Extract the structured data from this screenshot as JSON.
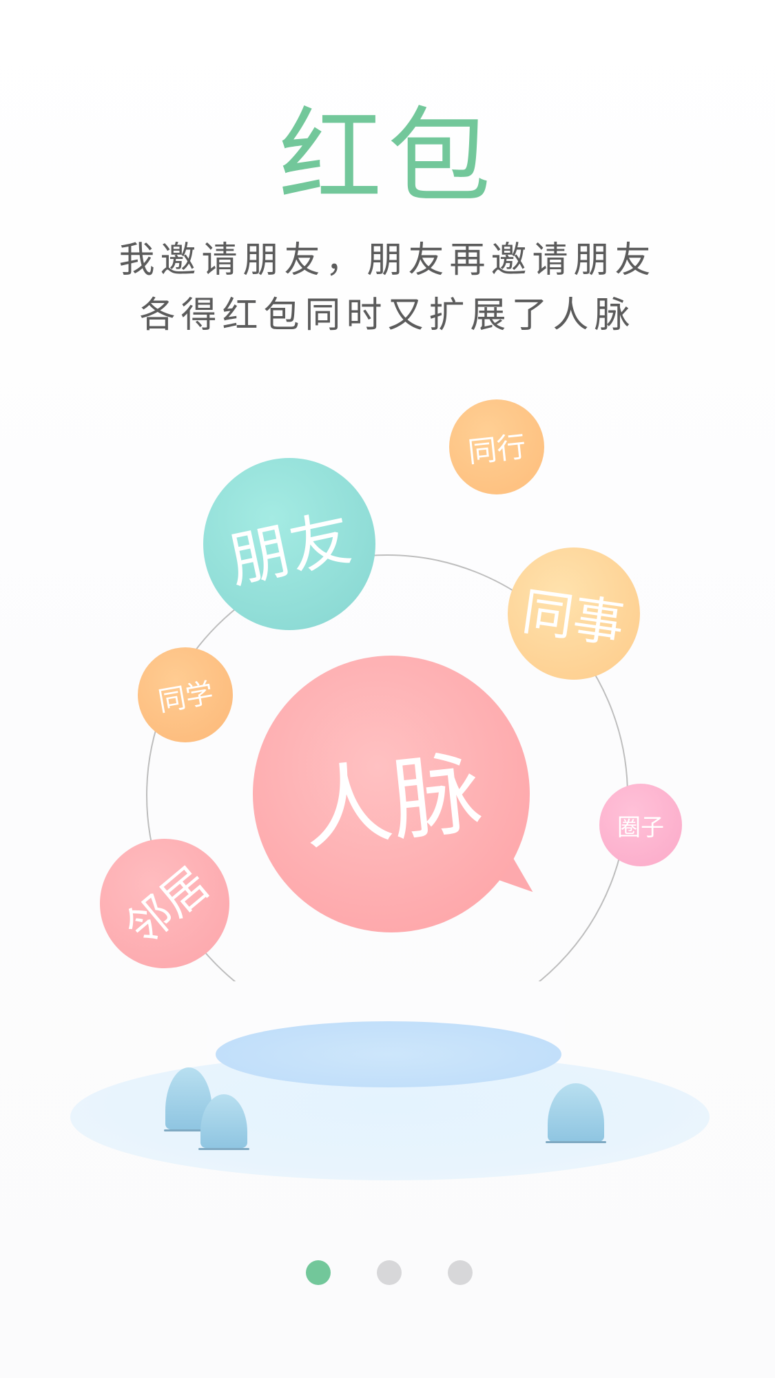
{
  "header": {
    "title": "红包",
    "subtitle_line1": "我邀请朋友，朋友再邀请朋友",
    "subtitle_line2": "各得红包同时又扩展了人脉"
  },
  "illustration": {
    "center_bubble": "人脉",
    "bubbles": {
      "friend": "朋友",
      "peer": "同行",
      "colleague": "同事",
      "classmate": "同学",
      "circle": "圈子",
      "neighbor": "邻居"
    }
  },
  "pager": {
    "total": 3,
    "active_index": 0
  },
  "colors": {
    "accent": "#72c79a",
    "subtitle_text": "#5b5b5b",
    "dot_inactive": "#d7d7d9",
    "friend_bubble": "#8fdcd6",
    "main_bubble": "#feaaad",
    "peer_bubble": "#fdbd7b",
    "base_water": "#bddcf9"
  }
}
